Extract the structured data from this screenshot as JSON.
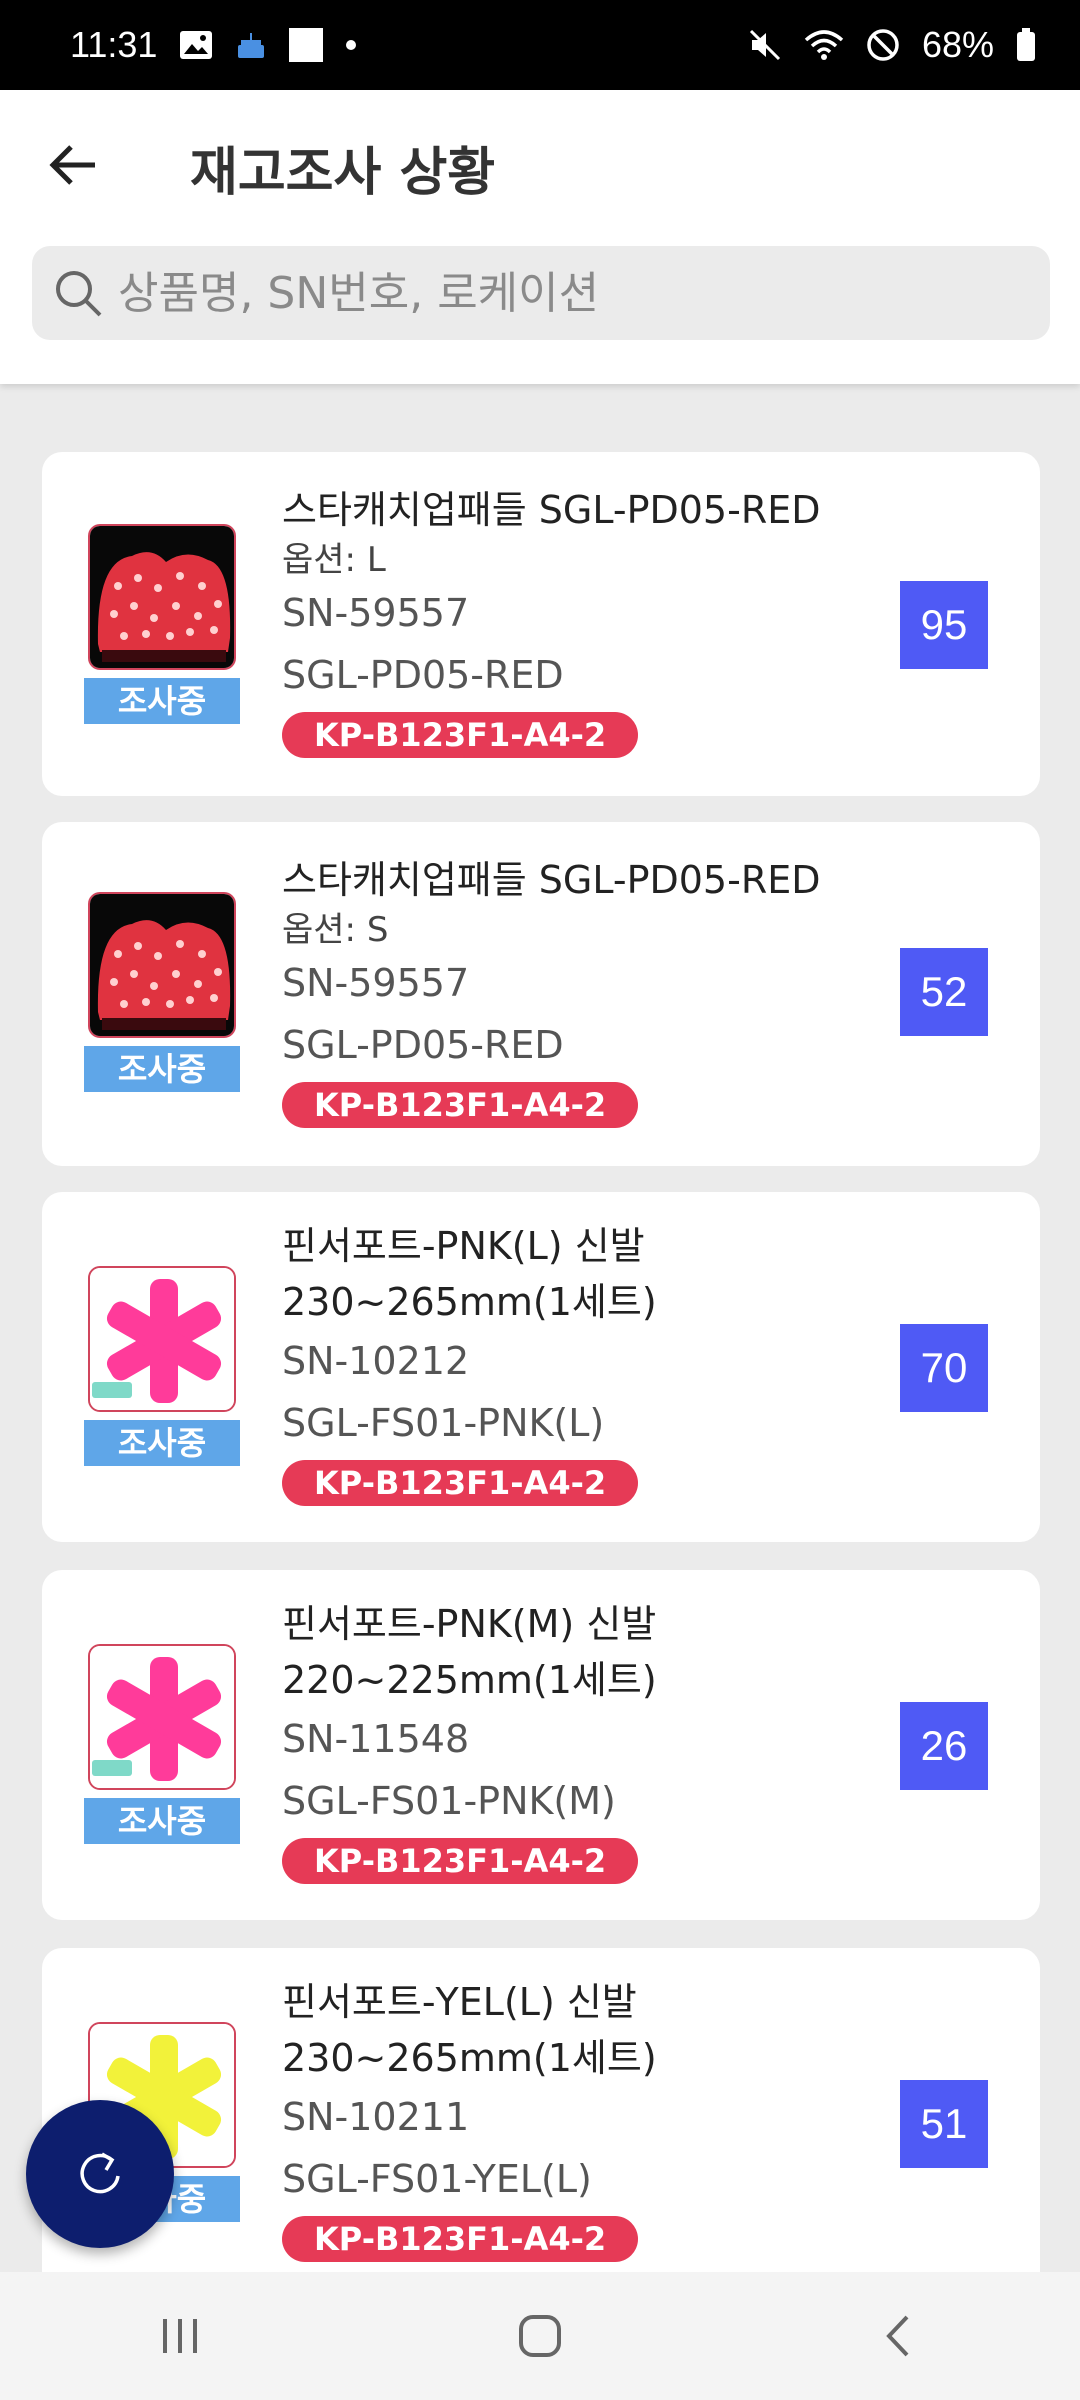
{
  "status_bar": {
    "time": "11:31",
    "battery": "68%"
  },
  "header": {
    "title": "재고조사 상황",
    "search_placeholder": "상품명, SN번호, 로케이션"
  },
  "items": [
    {
      "name": "스타캐치업패들 SGL-PD05-RED",
      "option": "옵션: L",
      "sn": "SN-59557",
      "code": "SGL-PD05-RED",
      "location": "KP-B123F1-A4-2",
      "status": "조사중",
      "quantity": "95",
      "image_icon": "red-paddle-image"
    },
    {
      "name": "스타캐치업패들 SGL-PD05-RED",
      "option": "옵션: S",
      "sn": "SN-59557",
      "code": "SGL-PD05-RED",
      "location": "KP-B123F1-A4-2",
      "status": "조사중",
      "quantity": "52",
      "image_icon": "red-paddle-image"
    },
    {
      "name": "핀서포트-PNK(L) 신발",
      "name2": "230~265mm(1세트)",
      "sn": "SN-10212",
      "code": "SGL-FS01-PNK(L)",
      "location": "KP-B123F1-A4-2",
      "status": "조사중",
      "quantity": "70",
      "image_icon": "pink-pin-support-image"
    },
    {
      "name": "핀서포트-PNK(M) 신발",
      "name2": "220~225mm(1세트)",
      "sn": "SN-11548",
      "code": "SGL-FS01-PNK(M)",
      "location": "KP-B123F1-A4-2",
      "status": "조사중",
      "quantity": "26",
      "image_icon": "pink-pin-support-image"
    },
    {
      "name": "핀서포트-YEL(L) 신발",
      "name2": "230~265mm(1세트)",
      "sn": "SN-10211",
      "code": "SGL-FS01-YEL(L)",
      "location": "KP-B123F1-A4-2",
      "status": "조사중",
      "quantity": "51",
      "image_icon": "yellow-pin-support-image"
    }
  ],
  "colors": {
    "status_tag": "#5fa6e8",
    "location_badge": "#e63a56",
    "quantity_box": "#4f5af5",
    "fab": "#0d1e6e"
  }
}
